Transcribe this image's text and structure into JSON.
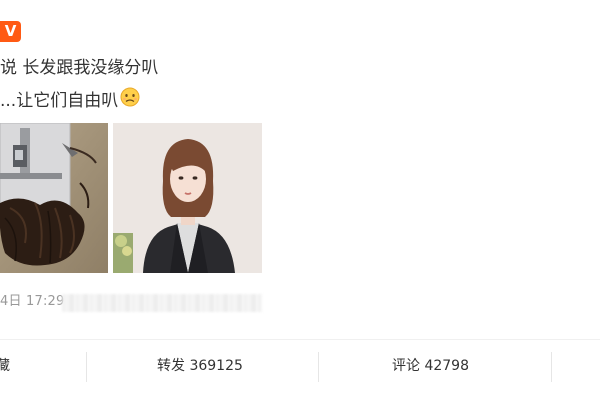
{
  "post": {
    "badge": "V",
    "line1": "说 长发跟我没缘分叭",
    "line2": "...让它们自由叭",
    "timestamp": "4日 17:29"
  },
  "images": [
    {
      "icon": "cut-hair-photo"
    },
    {
      "icon": "portrait-photo"
    }
  ],
  "actions": {
    "fav_partial": "藏",
    "repost": "转发 369125",
    "comment": "评论 42798"
  },
  "colors": {
    "badge": "#ff5a14",
    "text": "#333333",
    "muted": "#999999"
  }
}
